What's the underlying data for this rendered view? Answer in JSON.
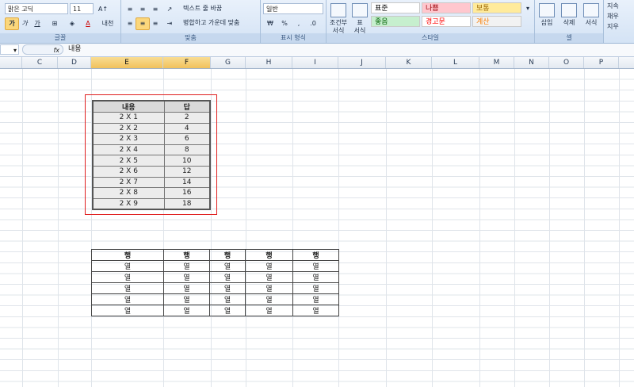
{
  "ribbon": {
    "font": {
      "name": "맑은 고딕",
      "size": "11",
      "group_label": "글꼴",
      "bold": "가",
      "italic": "가",
      "underline": "가",
      "script": "내천"
    },
    "alignment": {
      "wrap_text": "텍스트 줄 바꿈",
      "merge_center": "병합하고 가운데 맞춤",
      "group_label": "맞춤"
    },
    "number": {
      "format": "일반",
      "currency": "₩",
      "percent": "%",
      "comma": ",",
      "group_label": "표시 형식"
    },
    "styles": {
      "conditional": "조건부\n서식",
      "table_format": "표\n서식",
      "cells": [
        "표준",
        "나쁨",
        "보통",
        "좋음",
        "경고문",
        "계산"
      ],
      "cell_colors": [
        "#ffffff",
        "#ffc7ce",
        "#ffeb9c",
        "#c6efce",
        "#ffffff",
        "#f2f2f2"
      ],
      "text_colors": [
        "#000000",
        "#9c0006",
        "#9c6500",
        "#006100",
        "#ff0000",
        "#fa7d00"
      ],
      "group_label": "스타일"
    },
    "cells_group": {
      "insert": "삽입",
      "delete": "삭제",
      "format": "서식",
      "group_label": "셀"
    },
    "editing": {
      "sum": "지속",
      "fill": "채우",
      "clear": "지우"
    }
  },
  "formula_bar": {
    "fx": "fx",
    "content": "내용"
  },
  "columns": [
    "C",
    "D",
    "E",
    "F",
    "G",
    "H",
    "I",
    "J",
    "K",
    "L",
    "M",
    "N",
    "O",
    "P"
  ],
  "selected_columns": [
    "E",
    "F"
  ],
  "table1": {
    "headers": [
      "내용",
      "답"
    ],
    "rows": [
      [
        "2 X 1",
        "2"
      ],
      [
        "2 X 2",
        "4"
      ],
      [
        "2 X 3",
        "6"
      ],
      [
        "2 X 4",
        "8"
      ],
      [
        "2 X 5",
        "10"
      ],
      [
        "2 X 6",
        "12"
      ],
      [
        "2 X 7",
        "14"
      ],
      [
        "2 X 8",
        "16"
      ],
      [
        "2 X 9",
        "18"
      ]
    ]
  },
  "table2": {
    "headers": [
      "행",
      "행",
      "행",
      "행",
      "행"
    ],
    "rows": [
      [
        "열",
        "열",
        "열",
        "열",
        "열"
      ],
      [
        "열",
        "열",
        "열",
        "열",
        "열"
      ],
      [
        "열",
        "열",
        "열",
        "열",
        "열"
      ],
      [
        "열",
        "열",
        "열",
        "열",
        "열"
      ],
      [
        "열",
        "열",
        "열",
        "열",
        "열"
      ]
    ]
  }
}
